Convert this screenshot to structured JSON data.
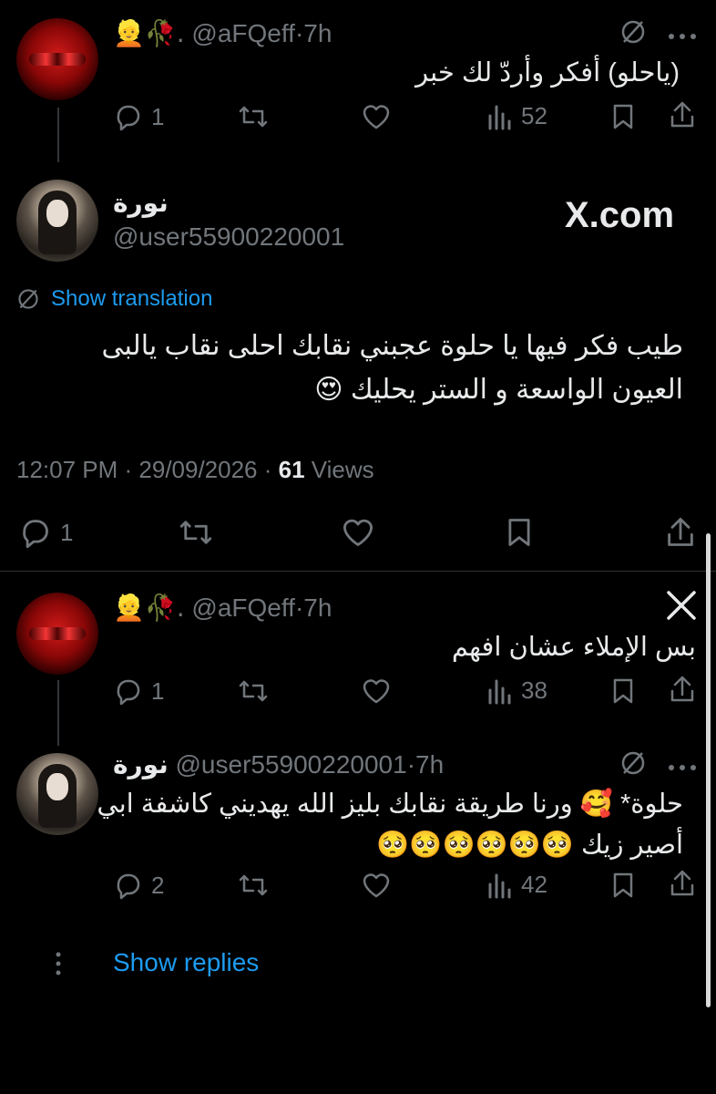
{
  "reply1": {
    "emoji": "👱🥀.",
    "handle": "@aFQeff",
    "sep": "·",
    "time": "7h",
    "text": "(ياحلو) أفكر وأردّ لك خبر",
    "replies": "1",
    "views": "52"
  },
  "main": {
    "display_name": "نورة",
    "handle": "@user55900220001",
    "watermark": "X.com",
    "show_translation": "Show translation",
    "text_line1": "طيب فكر فيها يا حلوة عجبني نقابك احلى نقاب يالبى",
    "text_line2": "العيون الواسعة و الستر يحليك 😍",
    "timestamp": "12:07 PM · 29/09/2026 · ",
    "views_count": "61",
    "views_label": " Views",
    "replies": "1"
  },
  "reply2": {
    "emoji": "👱🥀.",
    "handle": "@aFQeff",
    "sep": "·",
    "time": "7h",
    "text": "بس الإملاء عشان افهم",
    "replies": "1",
    "views": "38"
  },
  "reply3": {
    "display_name": "نورة",
    "handle": "@user55900220001",
    "sep": "·",
    "time": "7h",
    "text_line1": "حلوة* 🥰 ورنا طريقة نقابك بليز الله يهديني كاشفة ابي",
    "text_line2": "أصير زيك 🥺🥺🥺🥺🥺🥺",
    "replies": "2",
    "views": "42"
  },
  "show_replies": "Show replies",
  "colors": {
    "accent": "#1d9bf0",
    "muted": "#71767b",
    "background": "#000000",
    "text": "#e7e9ea"
  }
}
